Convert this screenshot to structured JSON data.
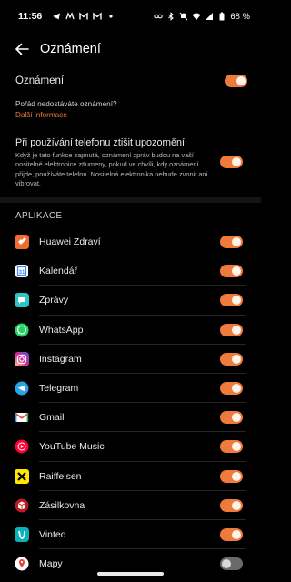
{
  "status": {
    "time": "11:56",
    "battery": "68 %",
    "left_icons": [
      "telegram-icon",
      "mail-icon",
      "gmail-icon",
      "gmail-icon",
      "dot-icon"
    ],
    "right_icons": [
      "link-icon",
      "bluetooth-icon",
      "mute-icon",
      "wifi-icon",
      "signal-icon",
      "battery-icon"
    ]
  },
  "header": {
    "title": "Oznámení",
    "back_icon": "arrow-left-icon"
  },
  "main_toggle": {
    "label": "Oznámení",
    "on": true
  },
  "help": {
    "question": "Pořád nedostáváte oznámení?",
    "link": "Další informace"
  },
  "silence": {
    "title": "Při používání telefonu ztišit upozornění",
    "description": "Když je tato funkce zapnutá, oznámení zpráv budou na vaší nositelné elektronice ztlumeny, pokud ve chvíli, kdy oznámení přijde, používáte telefon. Nositelná elektronika nebude zvonit ani vibrovat.",
    "on": true
  },
  "apps_section": {
    "title": "APLIKACE"
  },
  "apps": [
    {
      "name": "Huawei Zdraví",
      "icon": "huawei-health-icon",
      "color": "#f36b30",
      "on": true
    },
    {
      "name": "Kalendář",
      "icon": "calendar-icon",
      "color": "#ffffff",
      "on": true
    },
    {
      "name": "Zprávy",
      "icon": "messages-icon",
      "color": "#2ec5c5",
      "on": true
    },
    {
      "name": "WhatsApp",
      "icon": "whatsapp-icon",
      "color": "#25d366",
      "on": true
    },
    {
      "name": "Instagram",
      "icon": "instagram-icon",
      "color": "#d6249f",
      "on": true
    },
    {
      "name": "Telegram",
      "icon": "telegram-icon",
      "color": "#2aa3e3",
      "on": true
    },
    {
      "name": "Gmail",
      "icon": "gmail-icon",
      "color": "#ffffff",
      "on": true
    },
    {
      "name": "YouTube Music",
      "icon": "youtube-music-icon",
      "color": "#ff0033",
      "on": true
    },
    {
      "name": "Raiffeisen",
      "icon": "raiffeisen-icon",
      "color": "#ffe600",
      "on": true
    },
    {
      "name": "Zásilkovna",
      "icon": "zasilkovna-icon",
      "color": "#ba1b22",
      "on": true
    },
    {
      "name": "Vinted",
      "icon": "vinted-icon",
      "color": "#09b1ba",
      "on": true
    },
    {
      "name": "Mapy",
      "icon": "maps-icon",
      "color": "#ffffff",
      "on": false
    }
  ],
  "colors": {
    "accent": "#ee7a3b",
    "background": "#000000"
  }
}
